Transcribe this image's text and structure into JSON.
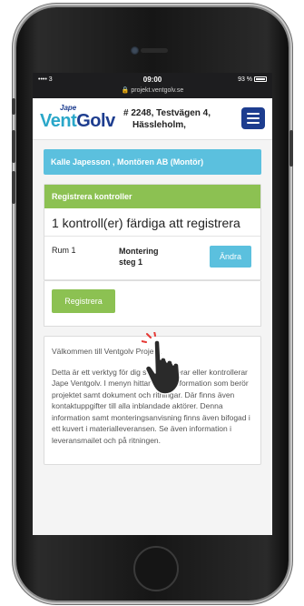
{
  "status_bar": {
    "signal": "•••• 3",
    "time": "09:00",
    "url": "🔒 projekt.ventgolv.se",
    "battery": "93 %"
  },
  "header": {
    "logo_top": "Jape",
    "logo_vent": "Vent",
    "logo_golv": "Golv",
    "project_line1": "# 2248, Testvägen 4,",
    "project_line2": "Hässleholm,"
  },
  "user_bar": "Kalle Japesson , Montören AB (Montör)",
  "register_panel": {
    "heading": "Registrera kontroller",
    "title": "1 kontroll(er) färdiga att registrera",
    "rows": [
      {
        "room": "Rum 1",
        "step": "Montering steg 1",
        "action": "Ändra"
      }
    ],
    "register_button": "Registrera"
  },
  "info": {
    "greeting": "Välkommen till Ventgolv Projekt.",
    "body": "Detta är ett verktyg för dig som monterar eller kontrollerar Jape Ventgolv. I menyn hittar du all information som berör projektet samt dokument och ritningar. Där finns även kontaktuppgifter till alla inblandade aktörer. Denna information samt monteringsanvisning finns även bifogad i ett kuvert i materialleveransen. Se även information i leveransmailet och på ritningen."
  },
  "colors": {
    "brand": "#1d3d8f",
    "info_blue": "#5bc0de",
    "success_green": "#8cc152"
  }
}
